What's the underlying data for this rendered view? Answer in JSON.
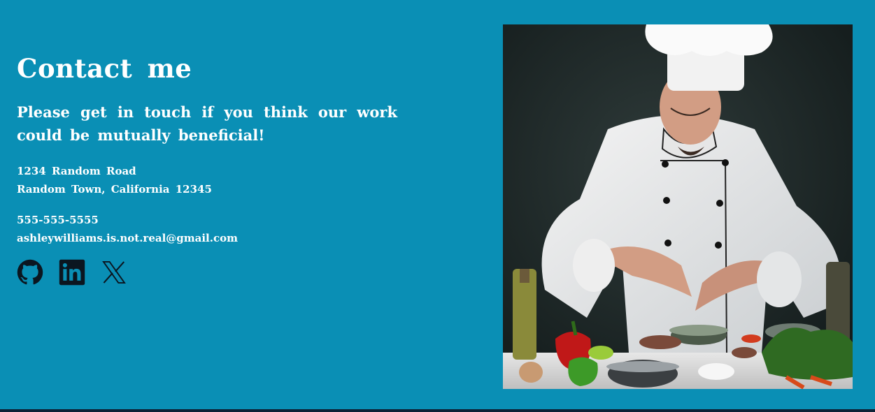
{
  "contact": {
    "heading": "Contact  me",
    "tagline": "Please get in touch if you think our work could be mutually beneficial!",
    "address_line1": "1234 Random Road",
    "address_line2": "Random Town, California 12345",
    "phone": "555-555-5555",
    "email": "ashleywilliams.is.not.real@gmail.com"
  },
  "socials": [
    {
      "icon": "github-icon"
    },
    {
      "icon": "linkedin-icon"
    },
    {
      "icon": "x-icon"
    }
  ],
  "colors": {
    "background": "#0a8fb5",
    "text": "#ffffff",
    "icons": "#0b1620",
    "bottom_bar": "#0d2236"
  }
}
